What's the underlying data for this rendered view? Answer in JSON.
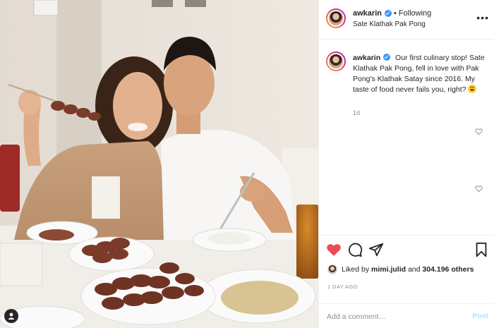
{
  "post": {
    "author": "awkarin",
    "follow_state": "Following",
    "separator": "•",
    "location": "Sate Klathak Pak Pong",
    "more_menu": "•••"
  },
  "caption": {
    "username": "awkarin",
    "text": "Our first culinary stop! Sate Klathak Pak Pong, fell in love with Pak Pong's Klathak Satay since 2016. My taste of food never fails you, right?",
    "age": "1d"
  },
  "engagement": {
    "liked_prefix": "Liked by",
    "liked_user": "mimi.julid",
    "liked_and": "and",
    "liked_count": "304.196",
    "liked_suffix": "others",
    "timestamp": "1 DAY AGO"
  },
  "comment_box": {
    "placeholder": "Add a comment…",
    "post_label": "Post"
  },
  "icons": {
    "like": "heart-filled-icon",
    "comment": "speech-bubble-icon",
    "share": "paper-plane-icon",
    "save": "bookmark-icon",
    "tag": "person-icon"
  },
  "colors": {
    "like_red": "#ed4956",
    "verified_blue": "#3897f0",
    "muted_text": "#8e8e8e",
    "post_button_disabled": "#b2dffc"
  }
}
